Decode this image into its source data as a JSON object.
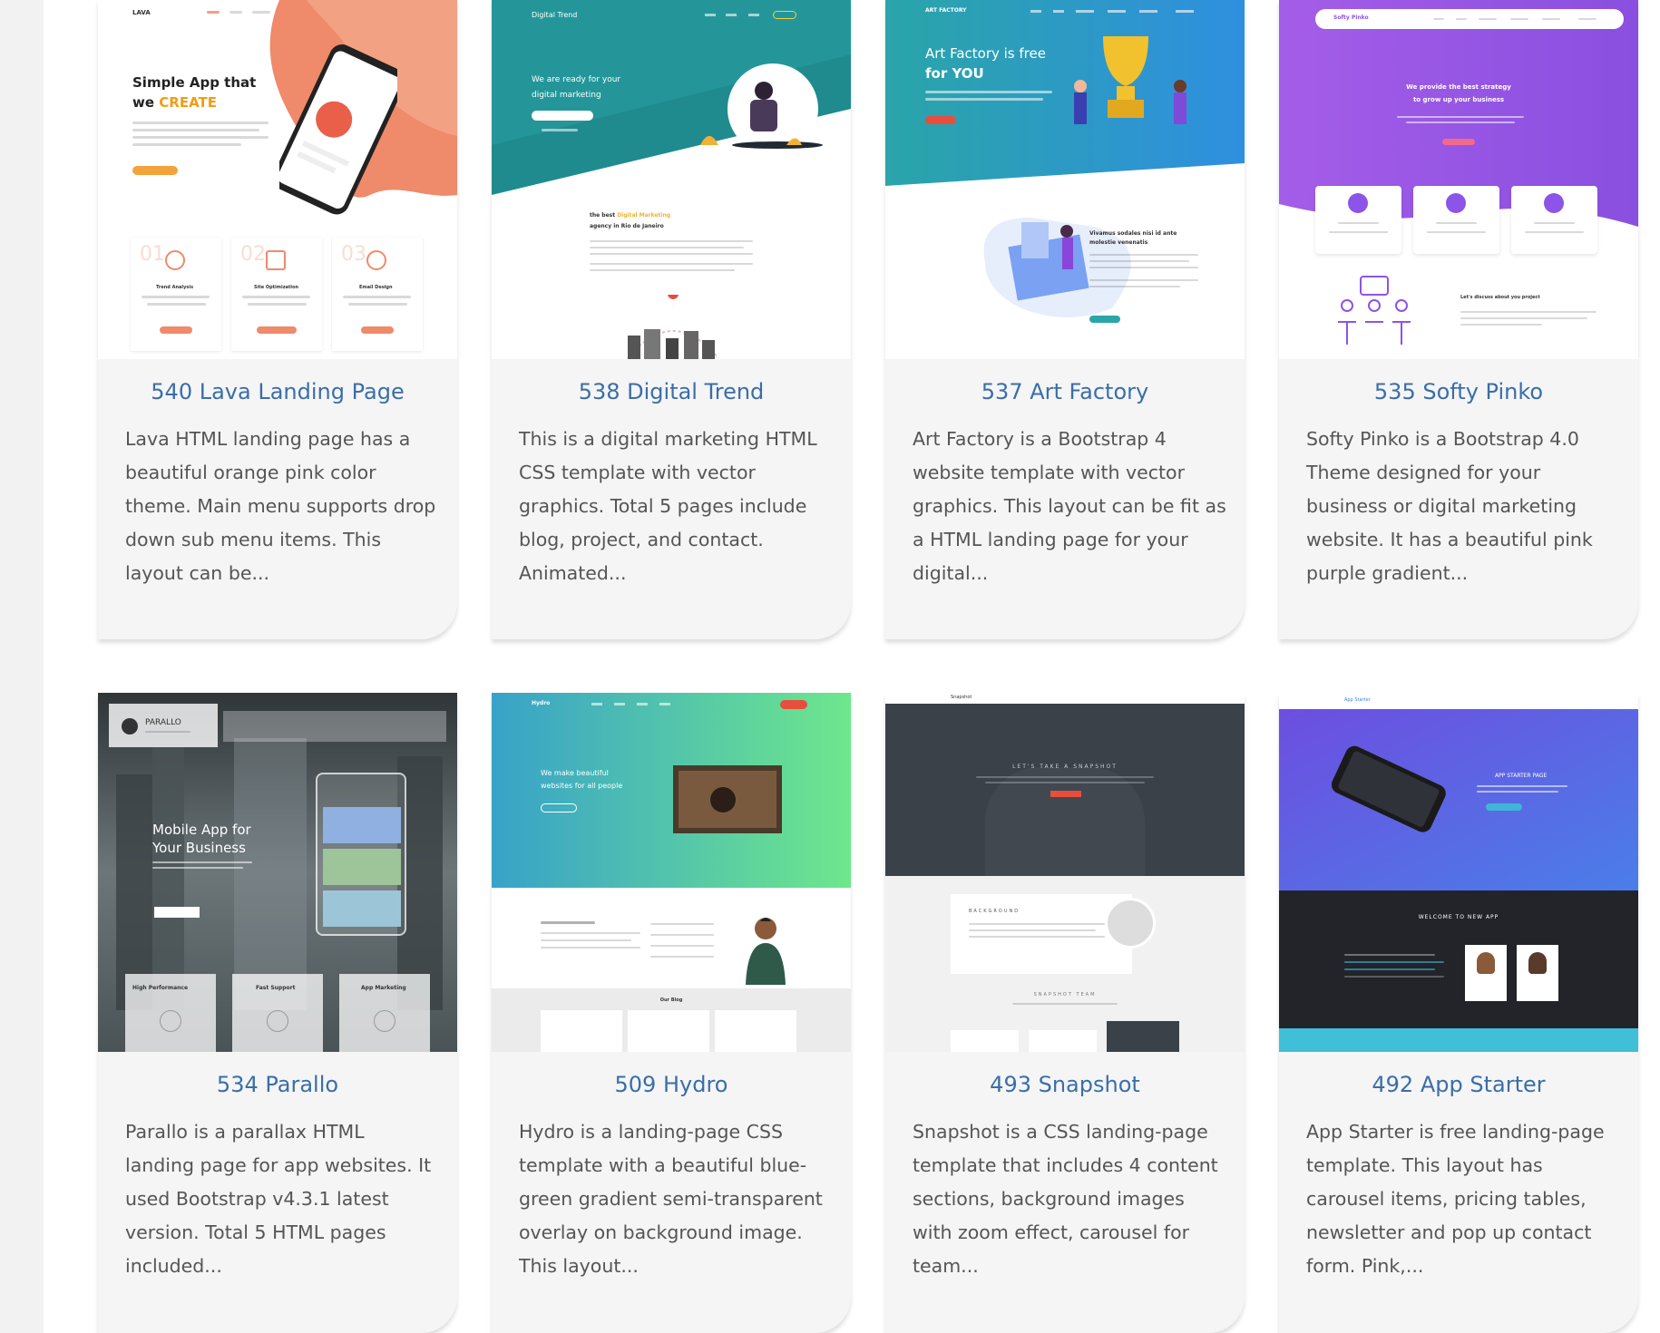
{
  "cards": [
    {
      "title": "540 Lava Landing Page",
      "description": "Lava HTML landing page has a beautiful orange pink color theme. Main menu supports drop down sub menu items. This layout can be...",
      "preview": {
        "brand": "LAVA",
        "headline_1": "Simple App that",
        "headline_2": "we",
        "headline_accent": "CREATE",
        "features": [
          "01",
          "02",
          "03"
        ],
        "feature_labels": [
          "Trend Analysis",
          "Site Optimization",
          "Email Design"
        ]
      }
    },
    {
      "title": "538 Digital Trend",
      "description": "This is a digital marketing HTML CSS template with vector graphics. Total 5 pages include blog, project, and contact. Animated...",
      "preview": {
        "brand": "Digital Trend",
        "hero_line_1": "We are ready for your",
        "hero_line_2": "digital marketing",
        "section_1": "the best",
        "section_accent": "Digital Marketing",
        "section_2": "agency in Rio de Janeiro"
      }
    },
    {
      "title": "537 Art Factory",
      "description": "Art Factory is a Bootstrap 4 website template with vector graphics. This layout can be fit as a HTML landing page for your digital...",
      "preview": {
        "brand": "ART FACTORY",
        "hero_line_1": "Art Factory is free",
        "hero_line_2": "for YOU",
        "section_1": "Vivamus sodales nisi id ante",
        "section_2": "molestie venenatis"
      }
    },
    {
      "title": "535 Softy Pinko",
      "description": "Softy Pinko is a Bootstrap 4.0 Theme designed for your business or digital marketing website. It has a beautiful pink purple gradient...",
      "preview": {
        "brand": "Softy Pinko",
        "hero_line_1": "We provide the best strategy",
        "hero_line_2": "to grow up your business",
        "section_1": "Let's discuss about you project"
      }
    },
    {
      "title": "534 Parallo",
      "description": "Parallo is a parallax HTML landing page for app websites. It used Bootstrap v4.3.1 latest version. Total 5 HTML pages included...",
      "preview": {
        "brand": "PARALLO",
        "hero_line_1": "Mobile App for",
        "hero_line_2": "Your Business",
        "features": [
          "High Performance",
          "Fast Support",
          "App Marketing"
        ]
      }
    },
    {
      "title": "509 Hydro",
      "description": "Hydro is a landing-page CSS template with a beautiful blue-green gradient semi-transparent overlay on background image. This layout...",
      "preview": {
        "brand": "Hydro",
        "hero_line_1": "We make beautiful",
        "hero_line_2": "websites for all people",
        "section_1": "Our Blog"
      }
    },
    {
      "title": "493 Snapshot",
      "description": "Snapshot is a CSS landing-page template that includes 4 content sections, background images with zoom effect, carousel for team...",
      "preview": {
        "brand": "Snapshot",
        "hero_line_1": "LET'S TAKE A SNAPSHOT",
        "section_1": "BACKGROUND",
        "section_2": "SNAPSHOT TEAM"
      }
    },
    {
      "title": "492 App Starter",
      "description": "App Starter is free landing-page template. This layout has carousel items, pricing tables, newsletter and pop up contact form. Pink,...",
      "preview": {
        "brand": "App Starter",
        "hero_line_1": "APP STARTER PAGE",
        "section_1": "WELCOME TO NEW APP"
      }
    }
  ],
  "colors": {
    "title": "#3a6ea8",
    "card_bg": "#f5f5f5",
    "lava_orange": "#ee7a5c",
    "digital_teal": "#1f8b8f",
    "art_blue": "#2f9fd6",
    "pinko_purple": "#8c54e8",
    "hydro_green": "#6ee78c",
    "snapshot_dark": "#3a4148",
    "appstarter_dark": "#22242a"
  }
}
